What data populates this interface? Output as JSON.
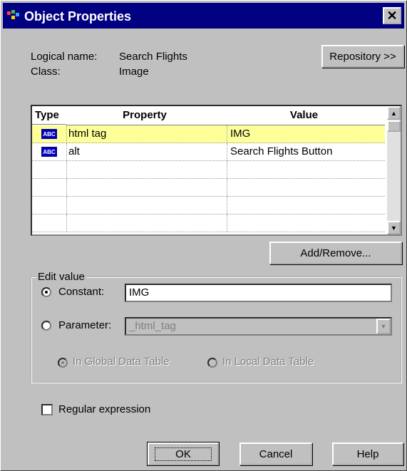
{
  "window": {
    "title": "Object Properties",
    "close_glyph": "✕"
  },
  "info": {
    "logical_name_label": "Logical name:",
    "logical_name_value": "Search Flights",
    "class_label": "Class:",
    "class_value": "Image"
  },
  "repository_button": "Repository >>",
  "grid": {
    "columns": [
      "Type",
      "Property",
      "Value"
    ],
    "rows": [
      {
        "type_icon": "abc-string-icon",
        "type_text": "ABC",
        "property": "html tag",
        "value": "IMG",
        "selected": true
      },
      {
        "type_icon": "abc-string-icon",
        "type_text": "ABC",
        "property": "alt",
        "value": "Search Flights Button",
        "selected": false
      }
    ],
    "empty_rows": 4
  },
  "add_remove_button": "Add/Remove...",
  "edit_value": {
    "legend": "Edit value",
    "constant_label": "Constant:",
    "constant_value": "IMG",
    "parameter_label": "Parameter:",
    "parameter_value": "_html_tag",
    "global_label": "In Global Data Table",
    "local_label": "In Local Data Table",
    "regex_label": "Regular expression",
    "constant_selected": true,
    "global_selected": true,
    "regex_checked": false
  },
  "footer": {
    "ok": "OK",
    "cancel": "Cancel",
    "help": "Help"
  },
  "colors": {
    "titlebar": "#000080",
    "dialog": "#c0c0c0",
    "selected_row": "#ffff99",
    "abc_icon": "#0000c0"
  }
}
